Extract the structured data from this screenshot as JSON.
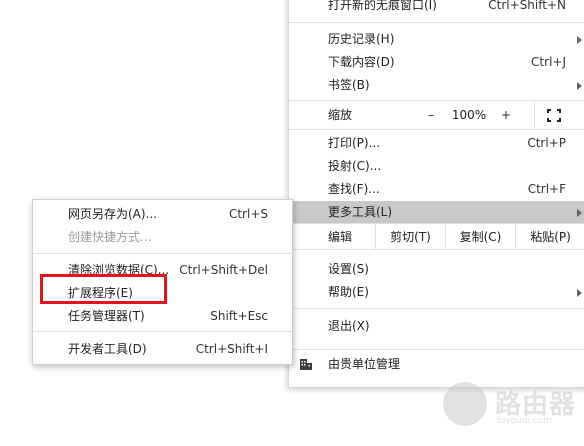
{
  "main_menu": {
    "incognito": {
      "label": "打开新的无痕窗口(I)",
      "shortcut": "Ctrl+Shift+N"
    },
    "history": {
      "label": "历史记录(H)"
    },
    "downloads": {
      "label": "下载内容(D)",
      "shortcut": "Ctrl+J"
    },
    "bookmarks": {
      "label": "书签(B)"
    },
    "zoom": {
      "label": "缩放",
      "minus": "–",
      "value": "100%",
      "plus": "+"
    },
    "print": {
      "label": "打印(P)...",
      "shortcut": "Ctrl+P"
    },
    "cast": {
      "label": "投射(C)..."
    },
    "find": {
      "label": "查找(F)...",
      "shortcut": "Ctrl+F"
    },
    "more_tools": {
      "label": "更多工具(L)"
    },
    "edit": {
      "label": "编辑",
      "cut": "剪切(T)",
      "copy": "复制(C)",
      "paste": "粘贴(P)"
    },
    "settings": {
      "label": "设置(S)"
    },
    "help": {
      "label": "帮助(E)"
    },
    "exit": {
      "label": "退出(X)"
    },
    "managed": {
      "label": "由贵单位管理"
    }
  },
  "sub_menu": {
    "save_page": {
      "label": "网页另存为(A)...",
      "shortcut": "Ctrl+S"
    },
    "create_shortcut": {
      "label": "创建快捷方式..."
    },
    "clear_data": {
      "label": "清除浏览数据(C)...",
      "shortcut": "Ctrl+Shift+Del"
    },
    "extensions": {
      "label": "扩展程序(E)"
    },
    "task_manager": {
      "label": "任务管理器(T)",
      "shortcut": "Shift+Esc"
    },
    "dev_tools": {
      "label": "开发者工具(D)",
      "shortcut": "Ctrl+Shift+I"
    }
  },
  "watermark": {
    "text": "路由器",
    "url": "luyouqi.com"
  },
  "colors": {
    "highlight_box": "#e5131b",
    "hover_row": "#c8c8c8"
  }
}
